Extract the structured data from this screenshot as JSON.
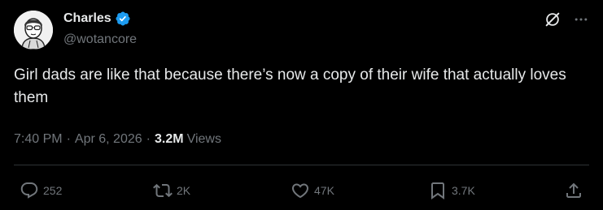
{
  "author": {
    "name": "Charles",
    "handle": "@wotancore",
    "verified": true,
    "verified_color": "#1d9bf0"
  },
  "tweet": {
    "text": "Girl dads are like that because there’s now a copy of their wife that actually loves them"
  },
  "meta": {
    "time": "7:40 PM",
    "separator": "·",
    "date": "Apr 6, 2026",
    "views_count": "3.2M",
    "views_label": "Views"
  },
  "actions": {
    "replies": "252",
    "reposts": "2K",
    "likes": "47K",
    "bookmarks": "3.7K"
  },
  "icons": {
    "grok": "grok-icon",
    "more": "more-horizontal-icon",
    "reply": "reply-icon",
    "repost": "repost-icon",
    "like": "heart-icon",
    "bookmark": "bookmark-icon",
    "share": "share-icon",
    "verified": "verified-badge-icon"
  },
  "colors": {
    "background": "#000000",
    "text_primary": "#e7e9ea",
    "text_secondary": "#71767b",
    "divider": "#2f3336"
  }
}
